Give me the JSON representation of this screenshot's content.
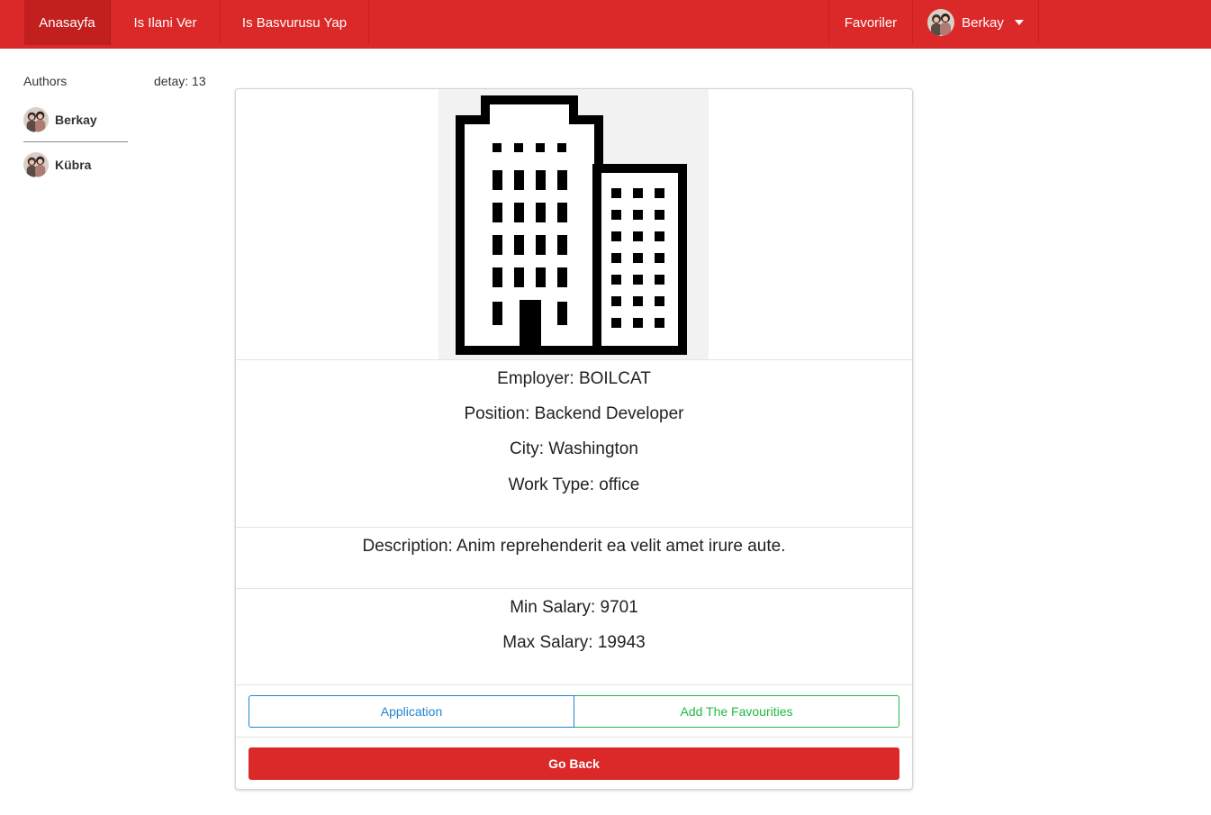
{
  "nav": {
    "home": "Anasayfa",
    "post_job": "Is Ilani Ver",
    "apply_job": "Is Basvurusu Yap",
    "favourites": "Favoriler",
    "user_name": "Berkay"
  },
  "sidebar": {
    "title": "Authors",
    "authors": [
      {
        "name": "Berkay"
      },
      {
        "name": "Kübra"
      }
    ]
  },
  "detail": {
    "label": "detay: 13"
  },
  "job": {
    "employer": "Employer: BOILCAT",
    "position": "Position: Backend Developer",
    "city": "City: Washington",
    "work_type": "Work Type: office",
    "description": "Description: Anim reprehenderit ea velit amet irure aute.",
    "min_salary": "Min Salary: 9701",
    "max_salary": "Max Salary: 19943"
  },
  "actions": {
    "application": "Application",
    "add_favourites": "Add The Favourities",
    "go_back": "Go Back"
  },
  "icons": {
    "building": "building-icon",
    "caret": "caret-down-icon",
    "avatar": "user-avatar"
  },
  "colors": {
    "primary_red": "#db2828",
    "active_red": "#c21f1f",
    "blue": "#2185d0",
    "green": "#21ba45"
  }
}
